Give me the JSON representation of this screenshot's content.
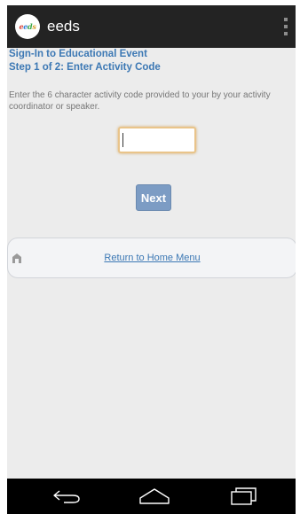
{
  "app": {
    "title": "eeds",
    "logo_text": "eeds"
  },
  "page": {
    "heading": "Sign-In to Educational Event",
    "step": "Step 1 of 2: Enter Activity Code",
    "instructions": "Enter the 6 character activity code provided to your by your activity coordinator or speaker."
  },
  "form": {
    "code_value": "",
    "next_label": "Next"
  },
  "home": {
    "link_label": "Return to Home Menu"
  },
  "icons": {
    "overflow": "overflow-menu-icon",
    "home": "home-icon",
    "back": "back-icon",
    "home_nav": "home-nav-icon",
    "recents": "recents-icon"
  },
  "colors": {
    "appbar": "#232323",
    "heading": "#3c78b4",
    "next_button": "#7c9cc4",
    "input_border": "#e9c48a",
    "background": "#ececec"
  }
}
